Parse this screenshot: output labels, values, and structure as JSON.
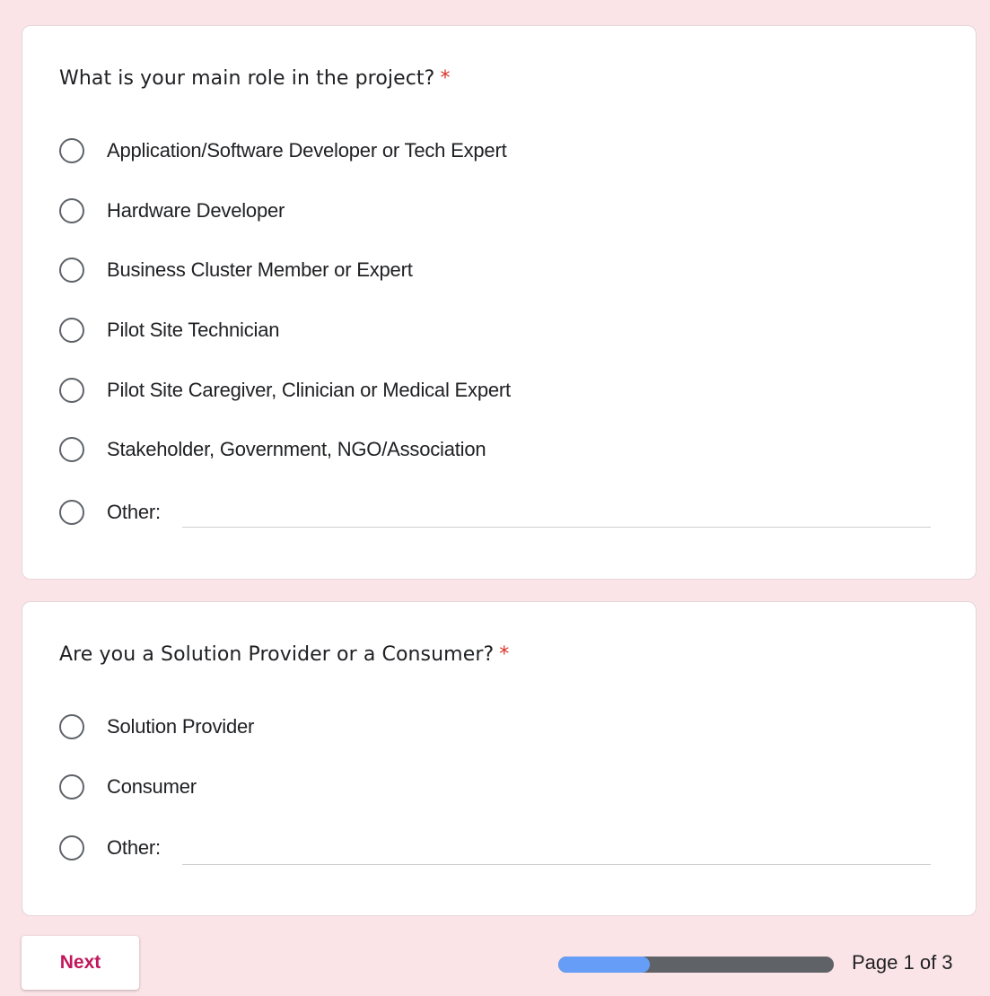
{
  "questions": [
    {
      "title": "What is your main role in the project?",
      "required_mark": "*",
      "options": [
        "Application/Software Developer or Tech Expert",
        "Hardware Developer",
        "Business Cluster Member or Expert",
        "Pilot Site Technician",
        "Pilot Site Caregiver, Clinician or Medical Expert",
        "Stakeholder, Government, NGO/Association"
      ],
      "other_label": "Other:",
      "other_value": ""
    },
    {
      "title": "Are you a Solution Provider or a Consumer?",
      "required_mark": "*",
      "options": [
        "Solution Provider",
        "Consumer"
      ],
      "other_label": "Other:",
      "other_value": ""
    }
  ],
  "footer": {
    "next_label": "Next",
    "page_indicator": "Page 1 of 3",
    "progress_fraction": 0.333
  },
  "colors": {
    "background": "#fbe4e8",
    "accent": "#c2185b",
    "required": "#d93025",
    "progress_fill": "#669df6",
    "progress_track": "#5f6368"
  }
}
